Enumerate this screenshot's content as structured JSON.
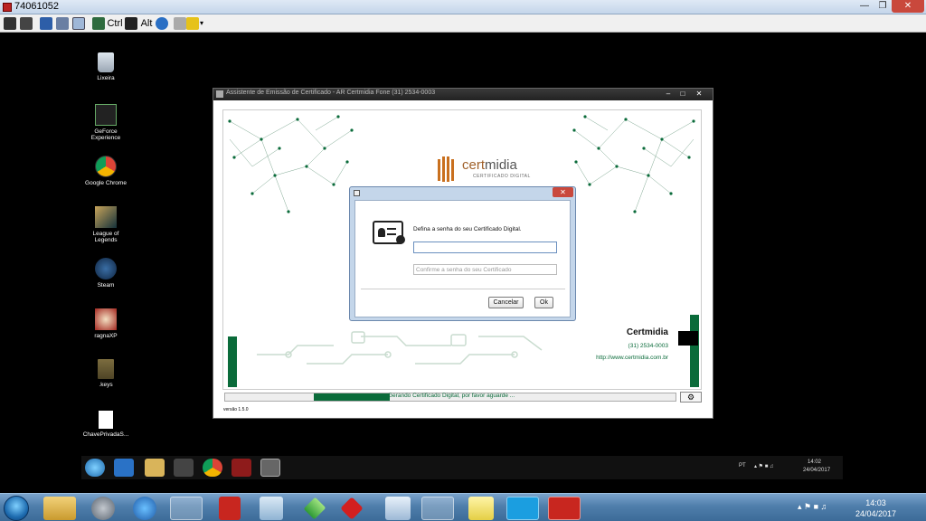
{
  "remote_session": {
    "title": "74061052",
    "toolbar": {
      "ctrl_label": "Ctrl",
      "alt_label": "Alt"
    }
  },
  "desktop_icons": [
    {
      "label": "Lixeira",
      "icon": "recycle-bin-icon"
    },
    {
      "label": "GeForce Experience",
      "icon": "geforce-icon"
    },
    {
      "label": "Google Chrome",
      "icon": "chrome-icon"
    },
    {
      "label": "League of Legends",
      "icon": "league-icon"
    },
    {
      "label": "Steam",
      "icon": "steam-icon"
    },
    {
      "label": "ragnaXP",
      "icon": "ragnaxp-icon"
    },
    {
      "label": ".keys",
      "icon": "folder-icon"
    },
    {
      "label": "ChavePrivadaS...",
      "icon": "file-icon"
    }
  ],
  "app_window": {
    "title": "Assistente de Emissão de Certificado - AR Certmidia Fone (31) 2534-0003",
    "logo_word_a": "cert",
    "logo_word_b": "midia",
    "logo_sub": "CERTIFICADO DIGITAL",
    "contact_name": "Certmidia",
    "contact_phone": "(31) 2534-0003",
    "contact_url": "http://www.certmidia.com.br",
    "progress_text": "Gerando Certificado Digital, por favor aguarde ...",
    "progress": 0.17,
    "version": "versão 1.5.0",
    "colors": {
      "accent": "#0a6b3a",
      "logo": "#a0612a"
    }
  },
  "dialog": {
    "prompt": "Defina a senha do seu Certificado Digital.",
    "password_value": "",
    "confirm_placeholder": "Confirme a senha do seu Certificado",
    "cancel_label": "Cancelar",
    "ok_label": "Ok"
  },
  "inner_taskbar": {
    "lang": "PT",
    "time": "14:02",
    "date": "24/04/2017"
  },
  "taskbar": {
    "time": "14:03",
    "date": "24/04/2017"
  }
}
